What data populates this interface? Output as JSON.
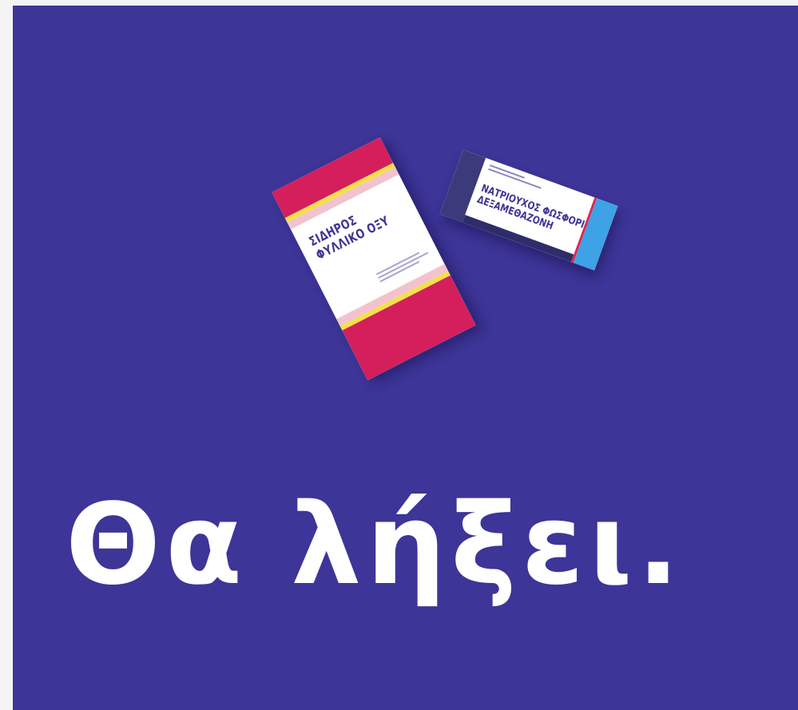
{
  "scene": {
    "background_color": "#3d3597",
    "headline": "Θα λήξει."
  },
  "boxes": {
    "iron_folic": {
      "name_line1": "ΣΙΔΗΡΟΣ",
      "name_line2": "ΦΥΛΛΙΚΟ ΟΞΥ",
      "main_color": "#d41f5c",
      "accent_color": "#f4e04a"
    },
    "dexamethasone": {
      "name_line1": "ΝΑΤΡΙΟΥΧΟΣ ΦΩΣΦΟΡΙΚΗ",
      "name_line2": "ΔΕΞΑΜΕΘΑΖΟΝΗ",
      "dark_color": "#3b3a7a",
      "light_color": "#3da2e6"
    }
  }
}
